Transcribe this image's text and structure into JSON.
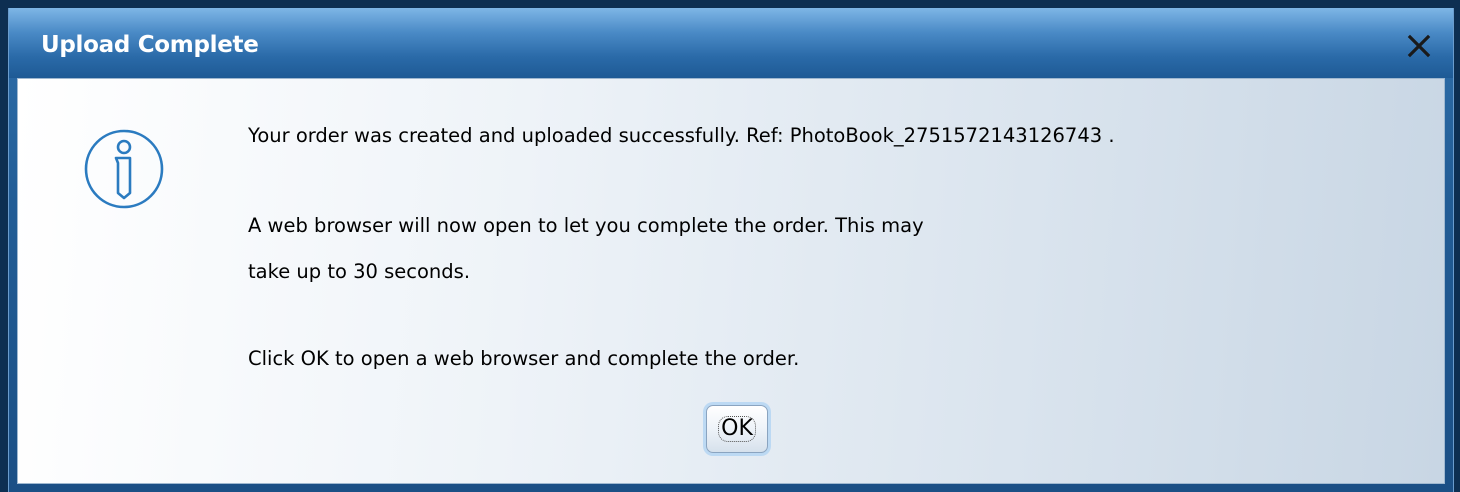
{
  "dialog": {
    "title": "Upload Complete",
    "close_icon": "close-icon",
    "info_icon": "info-icon",
    "messages": {
      "line1": "Your order was created and uploaded successfully. Ref: PhotoBook_2751572143126743 .",
      "line2": "A web browser will now open to let you complete the order. This may",
      "line3": "take up to 30 seconds.",
      "line4": "Click OK to open a web browser and complete the order."
    },
    "ok_label": "OK"
  },
  "colors": {
    "titlebar": "#2a6aa8",
    "content_bg": "#e6edf4",
    "icon_blue": "#2b7bc0"
  }
}
